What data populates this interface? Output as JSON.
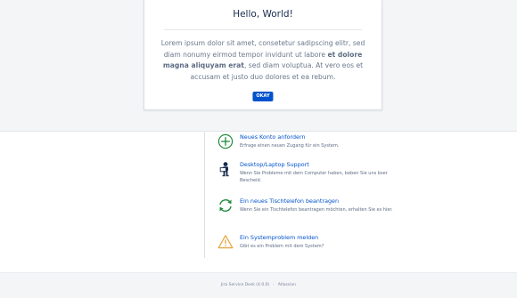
{
  "modal": {
    "title": "Hello, World!",
    "body_before": "Lorem ipsum dolor sit amet, consetetur sadipscing elitr, sed diam nonumy eirmod tempor invidunt ut labore ",
    "body_bold": "et dolore magna aliquyam erat",
    "body_after": ", sed diam voluptua. At vero eos et accusam et justo duo dolores et ea rebum.",
    "button_label": "OKAY",
    "button_color": "#0052cc"
  },
  "requests": [
    {
      "title": "Neues Konto anfordern",
      "description": "Erfrage einen neuen Zugang für ein System.",
      "icon": "plus-circle-icon",
      "color": "#1f8c3a"
    },
    {
      "title": "Desktop/Laptop Support",
      "description": "Wenn Sie Probleme mit dem Computer haben, beben Sie uns bser Bescheid.",
      "icon": "person-computer-icon",
      "color": "#172b4d"
    },
    {
      "title": "Ein neues Tischtelefon beantragen",
      "description": "Wenn Sie ein Tischtelefon beantragen möchten, erhalten Sie es hier.",
      "icon": "refresh-arrows-icon",
      "color": "#1f8c3a"
    },
    {
      "title": "Ein Systemproblem melden",
      "description": "Gibt es ein Problem mit dem System?",
      "icon": "warning-triangle-icon",
      "color": "#e8a33d"
    }
  ],
  "footer": {
    "product": "Jira Service Desk (4.0.0)",
    "separator": "·",
    "vendor": "Atlassian"
  }
}
